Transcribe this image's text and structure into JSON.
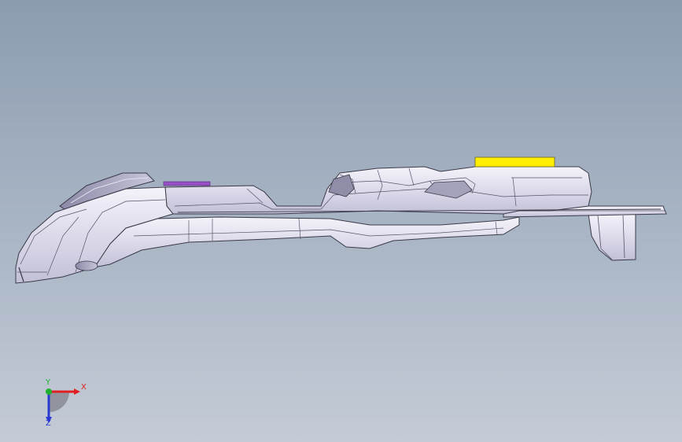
{
  "viewport": {
    "background_top": "#8c9cb0",
    "background_bottom": "#c4cbd6",
    "part_fill": "#e2e0ee",
    "part_edge": "#3a3a48",
    "highlight_yellow": "#ffee00",
    "highlight_purple": "#9a4fc8"
  },
  "triad": {
    "x_label": "X",
    "y_label": "Y",
    "z_label": "Z",
    "x_color": "#e02020",
    "y_color": "#20b030",
    "z_color": "#2a3ad0"
  }
}
